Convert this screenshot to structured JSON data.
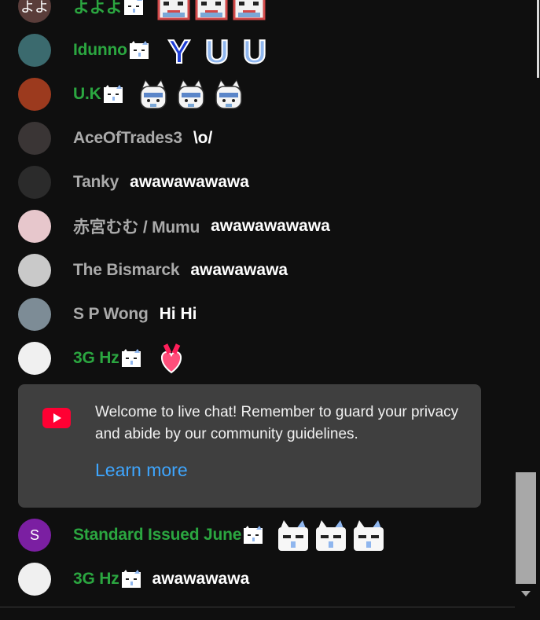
{
  "messages": [
    {
      "author": "よよよ",
      "member": true,
      "avatar_text": "よよ",
      "avatar_color": "#5a3d3a",
      "text": "",
      "emojis": [
        "pixel-face-emoji",
        "pixel-face-emoji",
        "pixel-face-emoji"
      ]
    },
    {
      "author": "Idunno",
      "member": true,
      "avatar_text": "",
      "avatar_color": "#3b6a6e",
      "text": "",
      "emojis": [
        "letter-y-emoji",
        "letter-u-emoji",
        "letter-u-emoji"
      ]
    },
    {
      "author": "U.K",
      "member": true,
      "avatar_text": "",
      "avatar_color": "#9c3a1e",
      "text": "",
      "emojis": [
        "cat-mask-emoji",
        "cat-mask-emoji",
        "cat-mask-emoji"
      ]
    },
    {
      "author": "AceOfTrades3",
      "member": false,
      "avatar_text": "",
      "avatar_color": "#3a3535",
      "text": "\\o/",
      "emojis": []
    },
    {
      "author": "Tanky",
      "member": false,
      "avatar_text": "",
      "avatar_color": "#2b2b2b",
      "text": "awawawawawa",
      "emojis": []
    },
    {
      "author": "赤宮むむ / Mumu",
      "member": false,
      "avatar_text": "",
      "avatar_color": "#e7c7cc",
      "text": "awawawawawa",
      "emojis": []
    },
    {
      "author": "The Bismarck",
      "member": false,
      "avatar_text": "",
      "avatar_color": "#c9c9c9",
      "text": "awawawawa",
      "emojis": []
    },
    {
      "author": "S P Wong",
      "member": false,
      "avatar_text": "",
      "avatar_color": "#7d8c96",
      "text": "Hi Hi",
      "emojis": []
    },
    {
      "author": "3G Hz",
      "member": true,
      "avatar_text": "",
      "avatar_color": "#f0f0f0",
      "text": "",
      "emojis": [
        "heart-cup-emoji"
      ]
    }
  ],
  "welcome": {
    "text": "Welcome to live chat! Remember to guard your privacy and abide by our community guidelines.",
    "link": "Learn more",
    "accent": "#3ea6ff",
    "icon": "youtube-icon"
  },
  "messages_after": [
    {
      "author": "Standard Issued June",
      "member": true,
      "avatar_text": "S",
      "avatar_color": "#7b1fa2",
      "text": "",
      "emojis": [
        "cat-face-emoji",
        "cat-face-emoji",
        "cat-face-emoji"
      ]
    },
    {
      "author": "3G Hz",
      "member": true,
      "avatar_text": "",
      "avatar_color": "#f0f0f0",
      "text": "awawawawa",
      "emojis": []
    }
  ],
  "colors": {
    "member": "#2ba640",
    "author": "#aaaaaa",
    "background": "#0f0f0f",
    "panel": "#3f3f3f"
  }
}
